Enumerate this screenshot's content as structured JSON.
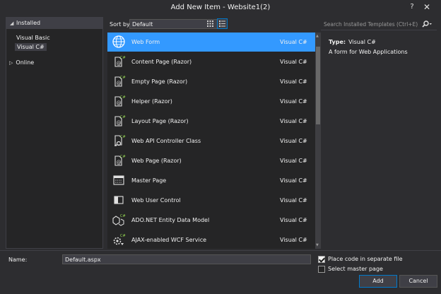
{
  "window": {
    "title": "Add New Item - Website1(2)",
    "help_label": "?",
    "close_label": "✕"
  },
  "left": {
    "installed_label": "Installed",
    "installed_children": [
      "Visual Basic",
      "Visual C#"
    ],
    "online_label": "Online"
  },
  "toolbar": {
    "sort_label": "Sort by:",
    "sort_value": "Default"
  },
  "search": {
    "placeholder": "Search Installed Templates (Ctrl+E)"
  },
  "templates": [
    {
      "name": "Web Form",
      "lang": "Visual C#",
      "icon": "globe-icon",
      "selected": true
    },
    {
      "name": "Content Page (Razor)",
      "lang": "Visual C#",
      "icon": "razor-file-icon"
    },
    {
      "name": "Empty Page (Razor)",
      "lang": "Visual C#",
      "icon": "razor-file-icon"
    },
    {
      "name": "Helper (Razor)",
      "lang": "Visual C#",
      "icon": "razor-file-icon"
    },
    {
      "name": "Layout Page (Razor)",
      "lang": "Visual C#",
      "icon": "razor-file-icon"
    },
    {
      "name": "Web API Controller Class",
      "lang": "Visual C#",
      "icon": "api-controller-icon"
    },
    {
      "name": "Web Page (Razor)",
      "lang": "Visual C#",
      "icon": "razor-file-icon"
    },
    {
      "name": "Master Page",
      "lang": "Visual C#",
      "icon": "master-page-icon"
    },
    {
      "name": "Web User Control",
      "lang": "Visual C#",
      "icon": "user-control-icon"
    },
    {
      "name": "ADO.NET Entity Data Model",
      "lang": "Visual C#",
      "icon": "entity-model-icon"
    },
    {
      "name": "AJAX-enabled WCF Service",
      "lang": "Visual C#",
      "icon": "wcf-service-icon"
    }
  ],
  "details": {
    "type_label": "Type:",
    "type_value": "Visual C#",
    "description": "A form for Web Applications"
  },
  "bottom": {
    "name_label": "Name:",
    "name_value": "Default.aspx",
    "place_code_label": "Place code in separate file",
    "place_code_checked": true,
    "select_master_label": "Select master page",
    "select_master_checked": false,
    "add_label": "Add",
    "cancel_label": "Cancel"
  },
  "colors": {
    "selection": "#3399ff",
    "background": "#2d2d30",
    "panel": "#252526",
    "accent": "#007acc"
  }
}
